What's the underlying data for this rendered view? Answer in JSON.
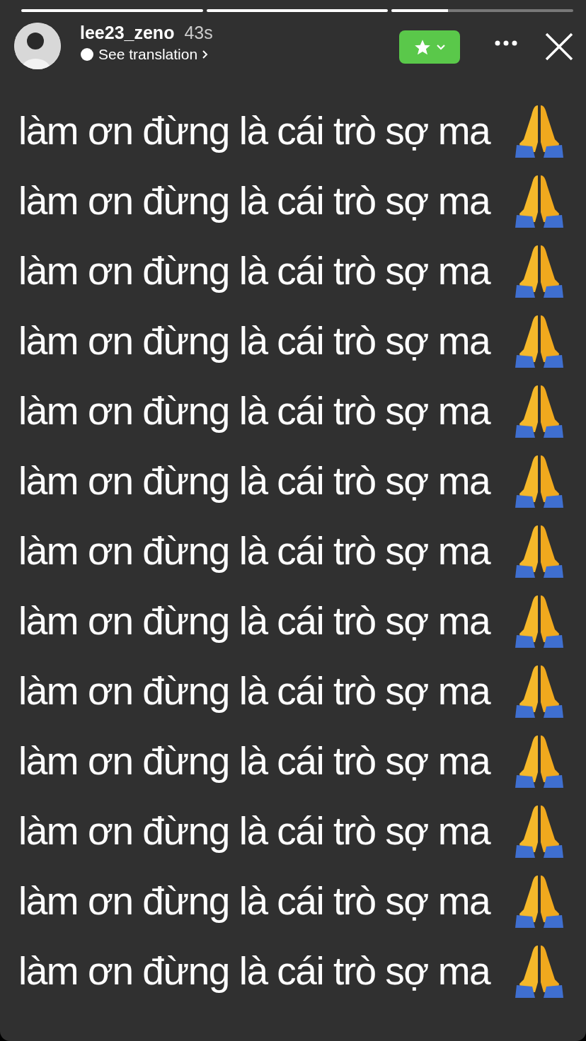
{
  "progress": [
    {
      "level": 1
    },
    {
      "level": 1
    },
    {
      "level": 0.31
    }
  ],
  "header": {
    "username": "lee23_zeno",
    "time": "43s",
    "translation": "See translation"
  },
  "lines": [
    "làm ơn đừng là cái trò sợ ma",
    "làm ơn đừng là cái trò sợ ma",
    "làm ơn đừng là cái trò sợ ma",
    "làm ơn đừng là cái trò sợ ma",
    "làm ơn đừng là cái trò sợ ma",
    "làm ơn đừng là cái trò sợ ma",
    "làm ơn đừng là cái trò sợ ma",
    "làm ơn đừng là cái trò sợ ma",
    "làm ơn đừng là cái trò sợ ma",
    "làm ơn đừng là cái trò sợ ma",
    "làm ơn đừng là cái trò sợ ma",
    "làm ơn đừng là cái trò sợ ma",
    "làm ơn đừng là cái trò sợ ma"
  ]
}
